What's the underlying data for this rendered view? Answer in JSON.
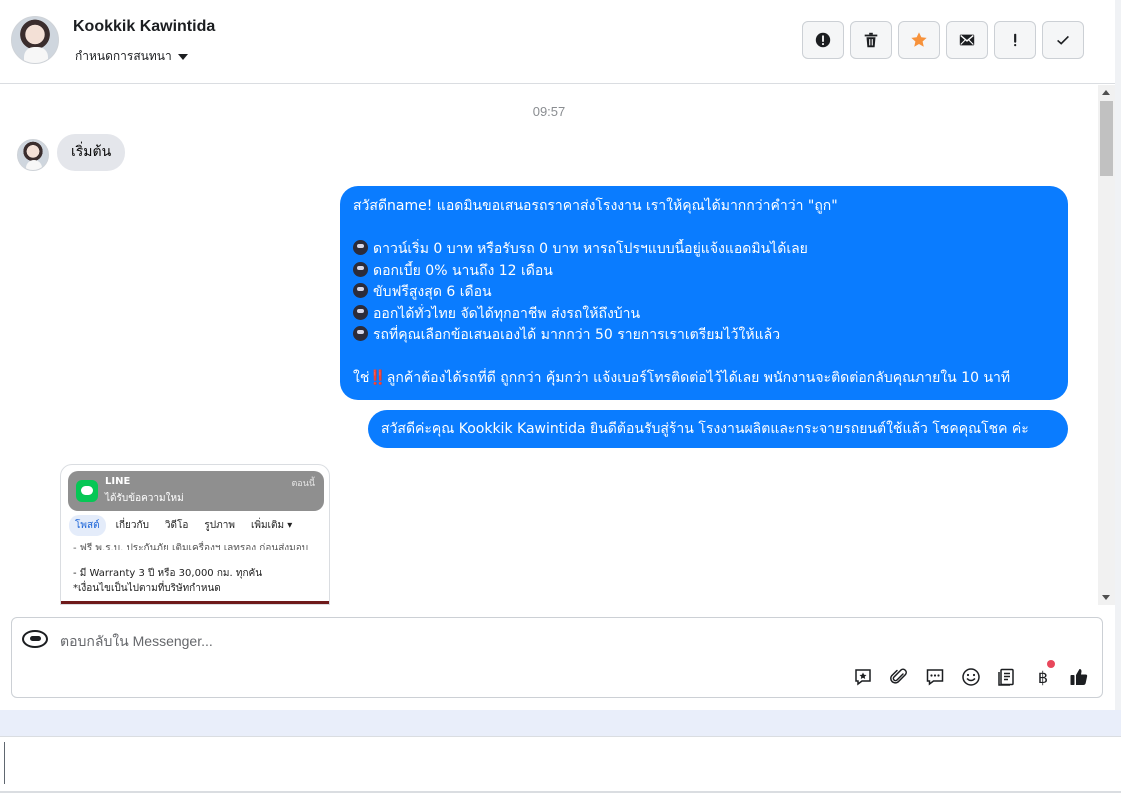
{
  "header": {
    "contact_name": "Kookkik Kawintida",
    "conversation_settings_label": "กำหนดการสนทนา",
    "actions": [
      {
        "name": "report-spam-button",
        "icon": "alert-circle-icon"
      },
      {
        "name": "delete-button",
        "icon": "trash-icon"
      },
      {
        "name": "star-button",
        "icon": "star-icon",
        "color": "#f7923b"
      },
      {
        "name": "mark-unread-button",
        "icon": "envelope-icon"
      },
      {
        "name": "follow-up-button",
        "icon": "exclamation-icon"
      },
      {
        "name": "mark-done-button",
        "icon": "checkmark-icon"
      }
    ]
  },
  "messages": {
    "timestamp": "09:57",
    "incoming": [
      {
        "text": "เริ่มต้น"
      }
    ],
    "outgoing_1": {
      "greeting": "สวัสดีname! แอดมินขอเสนอรถราคาส่งโรงงาน เราให้คุณได้มากกว่าคำว่า \"ถูก\"",
      "bullets": [
        "ดาวน์เริ่ม 0 บาท หรือรับรถ 0 บาท หารถโปรฯแบบนี้อยู่แจ้งแอดมินได้เลย",
        "ดอกเบี้ย 0% นานถึง 12 เดือน",
        "ขับฟรีสูงสุด 6 เดือน",
        "ออกได้ทั่วไทย จัดได้ทุกอาชีพ ส่งรถให้ถึงบ้าน",
        "รถที่คุณเลือกข้อเสนอเองได้ มากกว่า 50 รายการเราเตรียมไว้ให้แล้ว"
      ],
      "closing_prefix": "ใช่",
      "closing_emoji": "‼️",
      "closing_text": "ลูกค้าต้องได้รถที่ดี ถูกกว่า คุ้มกว่า แจ้งเบอร์โทรติดต่อไว้ได้เลย พนักงานจะติดต่อกลับคุณภายใน 10 นาที"
    },
    "outgoing_2": {
      "text": "สวัสดีค่ะคุณ Kookkik Kawintida ยินดีต้อนรับสู่ร้าน โรงงานผลิตและกระจายรถยนต์ใช้แล้ว โชคคุณโชค ค่ะ"
    },
    "image_preview": {
      "notif_app": "LINE",
      "notif_message": "ได้รับข้อความใหม่",
      "notif_time": "ตอนนี้",
      "tabs": [
        "โพสต์",
        "เกี่ยวกับ",
        "วิดีโอ",
        "รูปภาพ",
        "เพิ่มเติม ▾"
      ],
      "line_cut": "- ฟรี พ.ร.บ. ประกันภัย เติมเครื่องฯ เลทรอง ก่อนส่งมอบ",
      "line_warranty": "- มี Warranty 3 ปี หรือ 30,000 กม. ทุกคัน",
      "line_condition": "*เงื่อนไขเป็นไปตามที่บริษัทกำหนด"
    }
  },
  "composer": {
    "placeholder": "ตอบกลับใน Messenger...",
    "tools": [
      "saved-reply-icon",
      "paperclip-icon",
      "chat-bubble-icon",
      "emoji-icon",
      "catalog-icon",
      "baht-icon",
      "like-icon"
    ],
    "baht_symbol": "฿"
  }
}
